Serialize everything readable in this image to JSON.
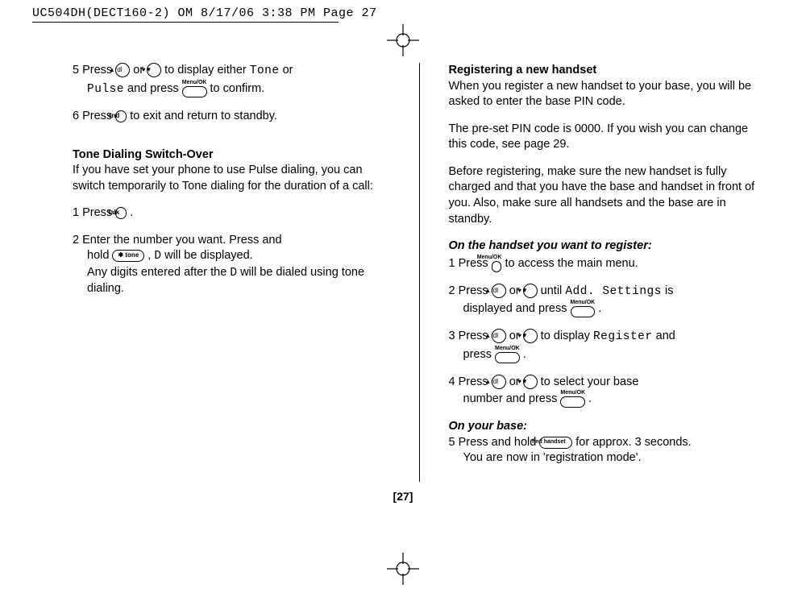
{
  "header": "UC504DH(DECT160-2) OM  8/17/06  3:38 PM  Page 27",
  "page_number": "[27]",
  "left": {
    "step5a": "5  Press ",
    "step5b": " or ",
    "step5c": " to display either ",
    "tone": "Tone",
    "step5d": " or",
    "pulse": "Pulse",
    "step5e": " and press ",
    "step5f": " to confirm.",
    "step6a": "6  Press ",
    "step6b": " to exit and return to standby.",
    "heading1": "Tone Dialing Switch-Over",
    "para1": "If you have set your phone to use Pulse dialing, you can switch temporarily to Tone dialing for the duration of a call:",
    "step1a": "1   Press ",
    "step1b": " .",
    "step2a": "2  Enter the number you want. Press and",
    "step2b": "hold ",
    "step2c": " , ",
    "d1": "D",
    "step2d": " will be displayed.",
    "step2e": "Any digits entered after the ",
    "d2": "D",
    "step2f": " will be dialed using tone dialing."
  },
  "right": {
    "heading1": "Registering a new handset",
    "para1": "When you register a new handset to your base, you will be asked to enter the base PIN code.",
    "para2": "The pre-set PIN code is 0000. If you wish you can change this code, see page 29.",
    "para3": "Before registering, make sure the new handset is fully charged and that you have the base and handset in front of you. Also, make sure all handsets and the base are in standby.",
    "sub1": "On the handset you want to register:",
    "r1a": "1  Press ",
    "r1b": " to access the main menu.",
    "r2a": "2  Press ",
    "r2b": " or ",
    "r2c": " until ",
    "add": "Add. Settings",
    "r2d": " is",
    "r2e": "displayed and press ",
    "r2f": " .",
    "r3a": "3  Press ",
    "r3b": " or ",
    "r3c": " to display ",
    "register": "Register",
    "r3d": " and",
    "r3e": "press ",
    "r3f": " .",
    "r4a": "4  Press ",
    "r4b": " or ",
    "r4c": " to select your base",
    "r4d": "number and press ",
    "r4e": " .",
    "sub2": "On your base:",
    "r5a": "5  Press and hold ",
    "r5b": " for approx. 3 seconds.",
    "r5c": "You are now in 'registration mode'."
  },
  "icons": {
    "up": "▲rdl",
    "down": "♥▼",
    "menu_label": "Menu/OK",
    "end": "end",
    "talk": "talk",
    "tone": "✱ tone",
    "find": "find handset"
  }
}
